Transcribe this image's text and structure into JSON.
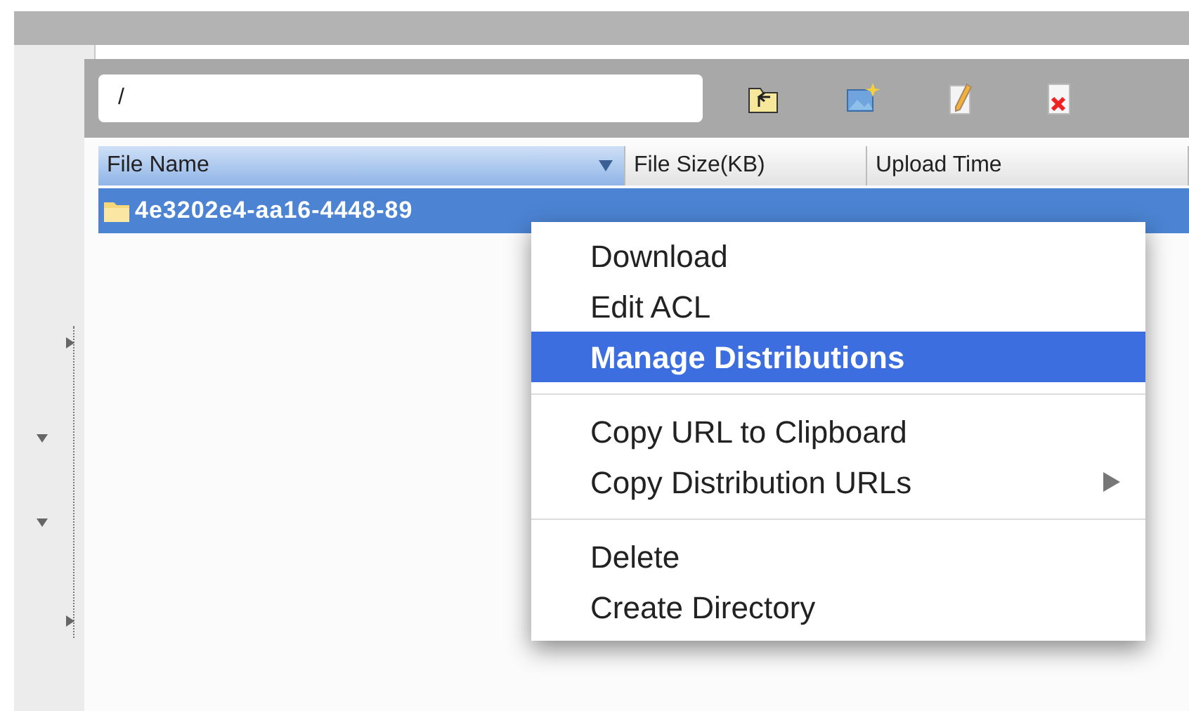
{
  "tree_toggles": [
    {
      "expanded": false
    },
    {
      "expanded": true
    },
    {
      "expanded": true
    },
    {
      "expanded": false
    }
  ],
  "path_field": {
    "value": "/"
  },
  "toolbar": [
    {
      "kind": "up-folder"
    },
    {
      "kind": "new-image"
    },
    {
      "kind": "edit"
    },
    {
      "kind": "delete"
    }
  ],
  "table": {
    "columns": [
      {
        "label": "File Name",
        "selected": true
      },
      {
        "label": "File Size(KB)",
        "selected": false
      },
      {
        "label": "Upload Time",
        "selected": false
      }
    ],
    "rows": [
      {
        "selected": true,
        "cells": [
          "4e3202e4-aa16-4448-89"
        ]
      }
    ]
  },
  "context_menu": {
    "groups": [
      [
        {
          "label": "Download",
          "selected": false
        },
        {
          "label": "Edit ACL",
          "selected": false
        },
        {
          "label": "Manage Distributions",
          "selected": true
        }
      ],
      [
        {
          "label": "Copy URL to Clipboard",
          "selected": false
        },
        {
          "label": "Copy Distribution URLs",
          "selected": false,
          "submenu": true
        }
      ],
      [
        {
          "label": "Delete",
          "selected": false
        },
        {
          "label": "Create Directory",
          "selected": false
        }
      ]
    ]
  }
}
